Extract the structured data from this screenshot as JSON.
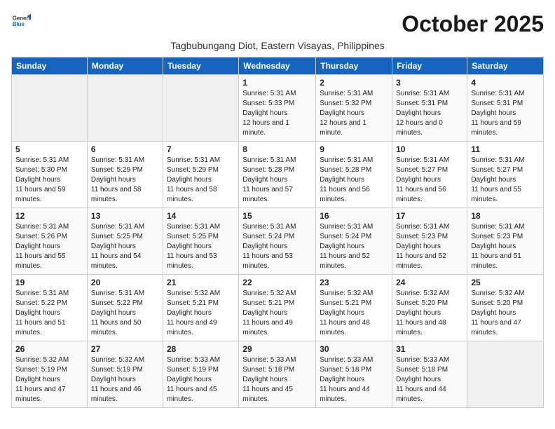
{
  "header": {
    "logo_line1": "General",
    "logo_line2": "Blue",
    "month_title": "October 2025",
    "subtitle": "Tagbubungang Diot, Eastern Visayas, Philippines"
  },
  "weekdays": [
    "Sunday",
    "Monday",
    "Tuesday",
    "Wednesday",
    "Thursday",
    "Friday",
    "Saturday"
  ],
  "weeks": [
    [
      null,
      null,
      null,
      {
        "day": "1",
        "sunrise": "5:31 AM",
        "sunset": "5:33 PM",
        "daylight": "12 hours and 1 minute."
      },
      {
        "day": "2",
        "sunrise": "5:31 AM",
        "sunset": "5:32 PM",
        "daylight": "12 hours and 1 minute."
      },
      {
        "day": "3",
        "sunrise": "5:31 AM",
        "sunset": "5:31 PM",
        "daylight": "12 hours and 0 minutes."
      },
      {
        "day": "4",
        "sunrise": "5:31 AM",
        "sunset": "5:31 PM",
        "daylight": "11 hours and 59 minutes."
      }
    ],
    [
      {
        "day": "5",
        "sunrise": "5:31 AM",
        "sunset": "5:30 PM",
        "daylight": "11 hours and 59 minutes."
      },
      {
        "day": "6",
        "sunrise": "5:31 AM",
        "sunset": "5:29 PM",
        "daylight": "11 hours and 58 minutes."
      },
      {
        "day": "7",
        "sunrise": "5:31 AM",
        "sunset": "5:29 PM",
        "daylight": "11 hours and 58 minutes."
      },
      {
        "day": "8",
        "sunrise": "5:31 AM",
        "sunset": "5:28 PM",
        "daylight": "11 hours and 57 minutes."
      },
      {
        "day": "9",
        "sunrise": "5:31 AM",
        "sunset": "5:28 PM",
        "daylight": "11 hours and 56 minutes."
      },
      {
        "day": "10",
        "sunrise": "5:31 AM",
        "sunset": "5:27 PM",
        "daylight": "11 hours and 56 minutes."
      },
      {
        "day": "11",
        "sunrise": "5:31 AM",
        "sunset": "5:27 PM",
        "daylight": "11 hours and 55 minutes."
      }
    ],
    [
      {
        "day": "12",
        "sunrise": "5:31 AM",
        "sunset": "5:26 PM",
        "daylight": "11 hours and 55 minutes."
      },
      {
        "day": "13",
        "sunrise": "5:31 AM",
        "sunset": "5:25 PM",
        "daylight": "11 hours and 54 minutes."
      },
      {
        "day": "14",
        "sunrise": "5:31 AM",
        "sunset": "5:25 PM",
        "daylight": "11 hours and 53 minutes."
      },
      {
        "day": "15",
        "sunrise": "5:31 AM",
        "sunset": "5:24 PM",
        "daylight": "11 hours and 53 minutes."
      },
      {
        "day": "16",
        "sunrise": "5:31 AM",
        "sunset": "5:24 PM",
        "daylight": "11 hours and 52 minutes."
      },
      {
        "day": "17",
        "sunrise": "5:31 AM",
        "sunset": "5:23 PM",
        "daylight": "11 hours and 52 minutes."
      },
      {
        "day": "18",
        "sunrise": "5:31 AM",
        "sunset": "5:23 PM",
        "daylight": "11 hours and 51 minutes."
      }
    ],
    [
      {
        "day": "19",
        "sunrise": "5:31 AM",
        "sunset": "5:22 PM",
        "daylight": "11 hours and 51 minutes."
      },
      {
        "day": "20",
        "sunrise": "5:31 AM",
        "sunset": "5:22 PM",
        "daylight": "11 hours and 50 minutes."
      },
      {
        "day": "21",
        "sunrise": "5:32 AM",
        "sunset": "5:21 PM",
        "daylight": "11 hours and 49 minutes."
      },
      {
        "day": "22",
        "sunrise": "5:32 AM",
        "sunset": "5:21 PM",
        "daylight": "11 hours and 49 minutes."
      },
      {
        "day": "23",
        "sunrise": "5:32 AM",
        "sunset": "5:21 PM",
        "daylight": "11 hours and 48 minutes."
      },
      {
        "day": "24",
        "sunrise": "5:32 AM",
        "sunset": "5:20 PM",
        "daylight": "11 hours and 48 minutes."
      },
      {
        "day": "25",
        "sunrise": "5:32 AM",
        "sunset": "5:20 PM",
        "daylight": "11 hours and 47 minutes."
      }
    ],
    [
      {
        "day": "26",
        "sunrise": "5:32 AM",
        "sunset": "5:19 PM",
        "daylight": "11 hours and 47 minutes."
      },
      {
        "day": "27",
        "sunrise": "5:32 AM",
        "sunset": "5:19 PM",
        "daylight": "11 hours and 46 minutes."
      },
      {
        "day": "28",
        "sunrise": "5:33 AM",
        "sunset": "5:19 PM",
        "daylight": "11 hours and 45 minutes."
      },
      {
        "day": "29",
        "sunrise": "5:33 AM",
        "sunset": "5:18 PM",
        "daylight": "11 hours and 45 minutes."
      },
      {
        "day": "30",
        "sunrise": "5:33 AM",
        "sunset": "5:18 PM",
        "daylight": "11 hours and 44 minutes."
      },
      {
        "day": "31",
        "sunrise": "5:33 AM",
        "sunset": "5:18 PM",
        "daylight": "11 hours and 44 minutes."
      },
      null
    ]
  ],
  "labels": {
    "sunrise": "Sunrise:",
    "sunset": "Sunset:",
    "daylight": "Daylight hours"
  }
}
